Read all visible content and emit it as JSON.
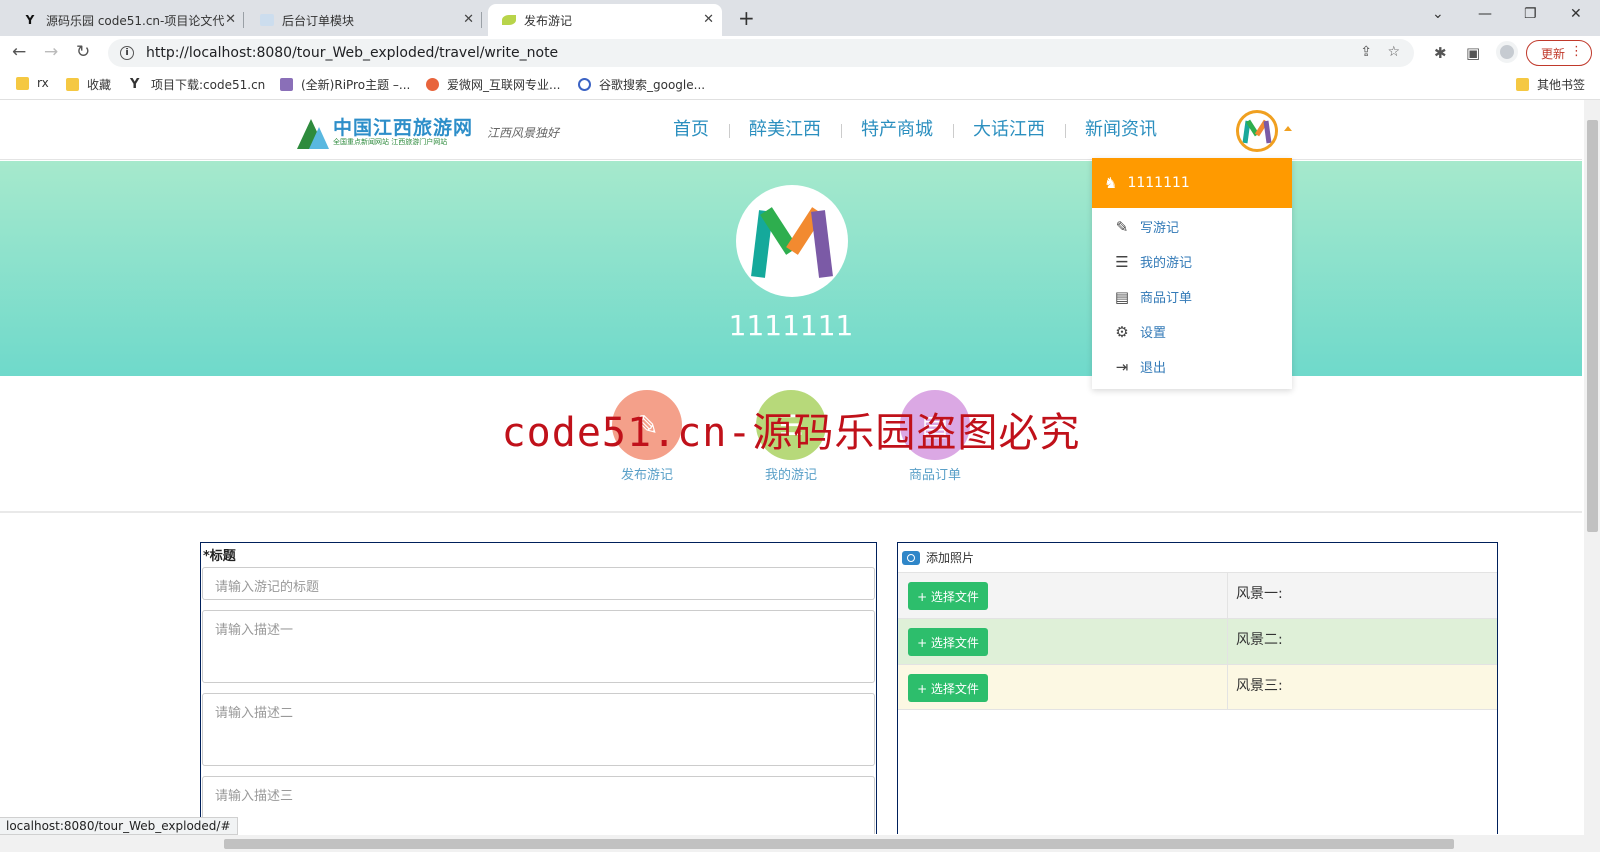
{
  "browser": {
    "tabs": [
      {
        "title": "源码乐园 code51.cn-项目论文代",
        "icon": "Y"
      },
      {
        "title": "后台订单模块",
        "icon": "img"
      },
      {
        "title": "发布游记",
        "icon": "leaf"
      }
    ],
    "url": "http://localhost:8080/tour_Web_exploded/travel/write_note",
    "update_label": "更新",
    "bookmarks": [
      "rx",
      "收藏",
      "项目下载:code51.cn",
      "(全新)RiPro主题 –...",
      "爱微网_互联网专业...",
      "谷歌搜索_google..."
    ],
    "other_bookmarks": "其他书签",
    "status_url": "localhost:8080/tour_Web_exploded/#"
  },
  "site": {
    "logo_title": "中国江西旅游网",
    "logo_subtitle": "全国重点新闻网站 江西旅游门户网站",
    "logo_sig": "江西风景独好",
    "nav": [
      "首页",
      "醉美江西",
      "特产商城",
      "大话江西",
      "新闻资讯"
    ],
    "username": "1111111",
    "dropdown": {
      "header": "1111111",
      "items": [
        {
          "icon": "edit-icon",
          "label": "写游记"
        },
        {
          "icon": "list-icon",
          "label": "我的游记"
        },
        {
          "icon": "clipboard-icon",
          "label": "商品订单"
        },
        {
          "icon": "gear-icon",
          "label": "设置"
        },
        {
          "icon": "logout-icon",
          "label": "退出"
        }
      ]
    },
    "quick": [
      {
        "label": "发布游记",
        "color": "#f4a08a"
      },
      {
        "label": "我的游记",
        "color": "#b7d97a"
      },
      {
        "label": "商品订单",
        "color": "#dba8e4"
      }
    ],
    "watermark": "code51.cn-源码乐园盗图必究"
  },
  "form": {
    "title_label": "*标题",
    "title_placeholder": "请输入游记的标题",
    "desc1_placeholder": "请输入描述一",
    "desc2_placeholder": "请输入描述二",
    "desc3_placeholder": "请输入描述三"
  },
  "photos": {
    "header": "添加照片",
    "button_label": "+ 选择文件",
    "rows": [
      {
        "label": "风景一:",
        "bg": "#f4f4f4"
      },
      {
        "label": "风景二:",
        "bg": "#dff0d8"
      },
      {
        "label": "风景三:",
        "bg": "#fcf8e3"
      }
    ]
  }
}
